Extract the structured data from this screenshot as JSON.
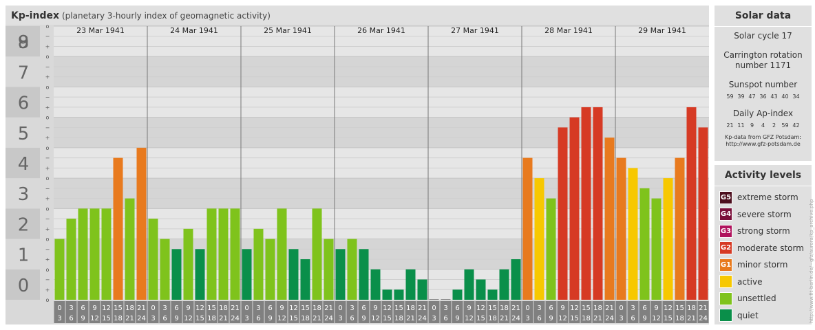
{
  "header": {
    "title": "Kp-index",
    "subtitle": "(planetary 3-hourly index of geomagnetic activity)"
  },
  "solar": {
    "title": "Solar data",
    "cycle": "Solar cycle 17",
    "carrington_line1": "Carrington rotation",
    "carrington_line2": "number 1171",
    "sunspot_title": "Sunspot number",
    "sunspot_values": [
      "59",
      "39",
      "47",
      "36",
      "43",
      "40",
      "34"
    ],
    "ap_title": "Daily Ap-index",
    "ap_values": [
      "21",
      "11",
      "9",
      "4",
      "2",
      "59",
      "42"
    ],
    "source_line1": "Kp-data from GFZ Potsdam:",
    "source_line2": "http://www.gfz-potsdam.de"
  },
  "activity": {
    "title": "Activity levels",
    "levels": [
      {
        "badge": "G5",
        "label": "extreme storm",
        "color": "#4d0f1e"
      },
      {
        "badge": "G4",
        "label": "severe storm",
        "color": "#7a0f3a"
      },
      {
        "badge": "G3",
        "label": "strong storm",
        "color": "#b0125c"
      },
      {
        "badge": "G2",
        "label": "moderate storm",
        "color": "#d63a24"
      },
      {
        "badge": "G1",
        "label": "minor storm",
        "color": "#e87a1e"
      },
      {
        "badge": "",
        "label": "active",
        "color": "#f7c800"
      },
      {
        "badge": "",
        "label": "unsettled",
        "color": "#7fc31c"
      },
      {
        "badge": "",
        "label": "quiet",
        "color": "#0a8f4a"
      }
    ]
  },
  "watermark": "http://www.fit-berlin.de/~gfz/aurora/kp_archive.php",
  "chart_data": {
    "type": "bar",
    "title": "Kp-index",
    "subtitle": "(planetary 3-hourly index of geomagnetic activity)",
    "ylim": [
      0,
      9
    ],
    "y_ticks": [
      "0",
      "1",
      "2",
      "3",
      "4",
      "5",
      "6",
      "7",
      "8",
      "9"
    ],
    "y_minor_ticks": [
      "o",
      "+",
      "−"
    ],
    "days": [
      "23 Mar 1941",
      "24 Mar 1941",
      "25 Mar 1941",
      "26 Mar 1941",
      "27 Mar 1941",
      "28 Mar 1941",
      "29 Mar 1941"
    ],
    "interval_starts": [
      "0",
      "3",
      "6",
      "9",
      "12",
      "15",
      "18",
      "21"
    ],
    "interval_ends": [
      "3",
      "6",
      "9",
      "12",
      "15",
      "18",
      "21",
      "24"
    ],
    "series": [
      {
        "values": [
          [
            2,
            2.667,
            3,
            3,
            3,
            4.667,
            3.333,
            5
          ],
          [
            2.667,
            2,
            1.667,
            2.333,
            1.667,
            3,
            3,
            3
          ],
          [
            1.667,
            2.333,
            2,
            3,
            1.667,
            1.333,
            3,
            2
          ],
          [
            1.667,
            2,
            1.667,
            1,
            0.333,
            0.333,
            1,
            0.667
          ],
          [
            0,
            0,
            0.333,
            1,
            0.667,
            0.333,
            1,
            1.333
          ],
          [
            4.667,
            4,
            3.333,
            5.667,
            6,
            6.333,
            6.333,
            5.333
          ],
          [
            4.667,
            4.333,
            3.667,
            3.333,
            4,
            4.667,
            6.333,
            5.667
          ]
        ]
      }
    ]
  }
}
